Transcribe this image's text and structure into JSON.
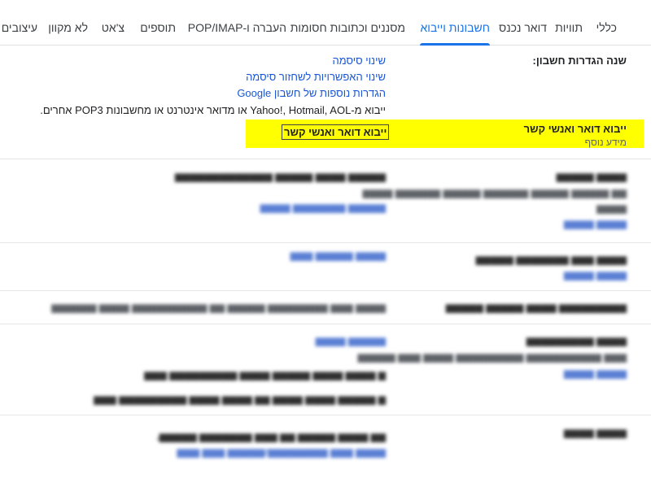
{
  "tabs": [
    {
      "label": "כללי",
      "active": false
    },
    {
      "label": "תוויות",
      "active": false
    },
    {
      "label": "דואר נכנס",
      "active": false
    },
    {
      "label": "חשבונות וייבוא",
      "active": true
    },
    {
      "label": "מסננים וכתובות חסומות",
      "active": false
    },
    {
      "label": "העברה ו-POP/IMAP",
      "active": false
    },
    {
      "label": "תוספים",
      "active": false
    },
    {
      "label": "צ'אט",
      "active": false
    },
    {
      "label": "לא מקוון",
      "active": false
    },
    {
      "label": "עיצובים",
      "active": false
    }
  ],
  "change_account": {
    "label": "שנה הגדרות חשבון:",
    "links": [
      "שינוי סיסמה",
      "שינוי האפשרויות לשחזור סיסמה",
      "הגדרות נוספות של חשבון Google"
    ]
  },
  "import_info": "ייבוא מ-Yahoo!, Hotmail, AOL או מדואר אינטרנט או מחשבונות POP3 אחרים.",
  "import_section": {
    "label": "ייבוא דואר ואנשי קשר",
    "learn_more": "מידע נוסף",
    "button": "ייבוא דואר ואנשי קשר"
  },
  "colors": {
    "active_tab": "#1a73e8",
    "link": "#1a56d6",
    "highlight": "#ffff00"
  }
}
